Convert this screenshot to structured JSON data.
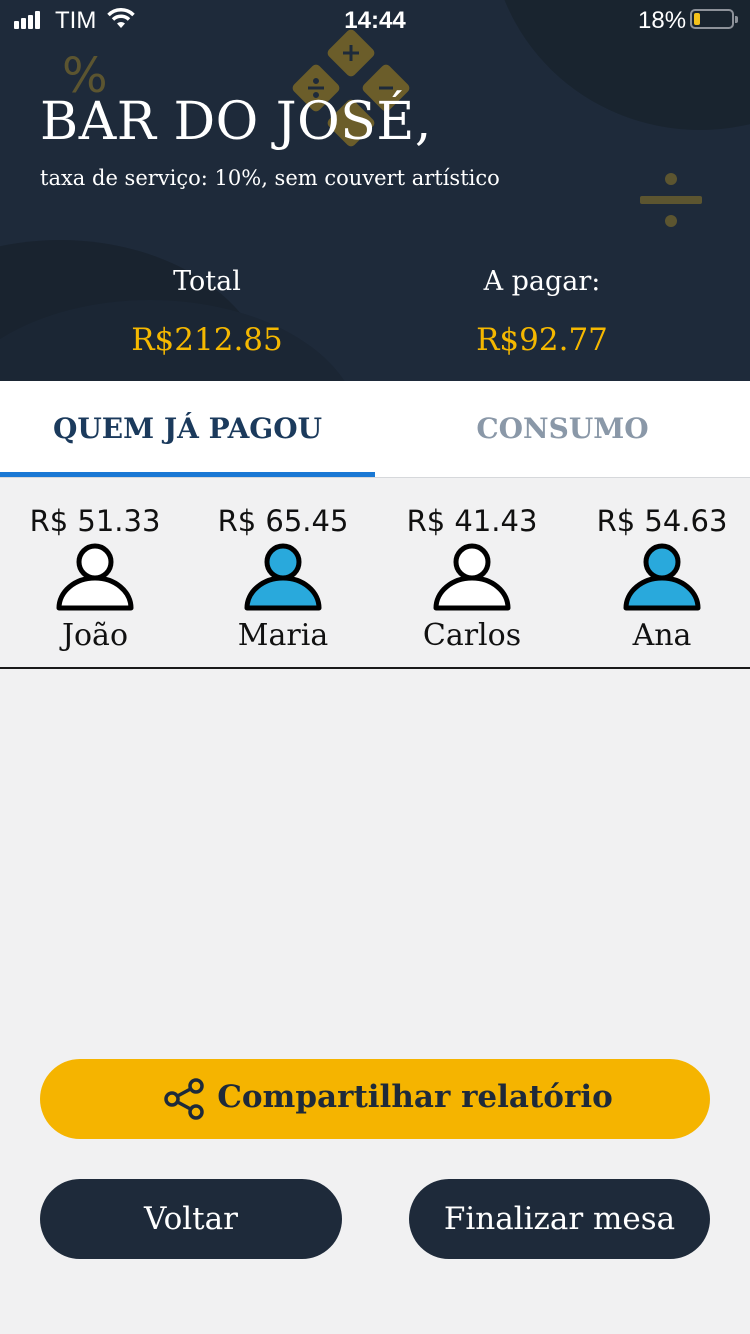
{
  "status_bar": {
    "carrier": "TIM",
    "time": "14:44",
    "battery_percent": "18%"
  },
  "header": {
    "title": "BAR DO JOSÉ,",
    "subtitle": "taxa de serviço: 10%, sem couvert artístico",
    "total_label": "Total",
    "total_value": "R$212.85",
    "to_pay_label": "A pagar:",
    "to_pay_value": "R$92.77"
  },
  "tabs": [
    {
      "label": "QUEM JÁ PAGOU",
      "active": true
    },
    {
      "label": "CONSUMO",
      "active": false
    }
  ],
  "people": [
    {
      "amount": "R$ 51.33",
      "name": "João",
      "paid": false
    },
    {
      "amount": "R$ 65.45",
      "name": "Maria",
      "paid": true
    },
    {
      "amount": "R$ 41.43",
      "name": "Carlos",
      "paid": false
    },
    {
      "amount": "R$ 54.63",
      "name": "Ana",
      "paid": true
    }
  ],
  "buttons": {
    "share": "Compartilhar relatório",
    "back": "Voltar",
    "finish": "Finalizar mesa"
  },
  "colors": {
    "header_bg": "#1e2a3a",
    "accent_yellow": "#f5b400",
    "paid_blue": "#29a9dc",
    "tab_underline": "#1a78d4"
  },
  "icons": {
    "share": "share-icon",
    "person_paid": "person-filled-icon",
    "person_unpaid": "person-outline-icon"
  }
}
